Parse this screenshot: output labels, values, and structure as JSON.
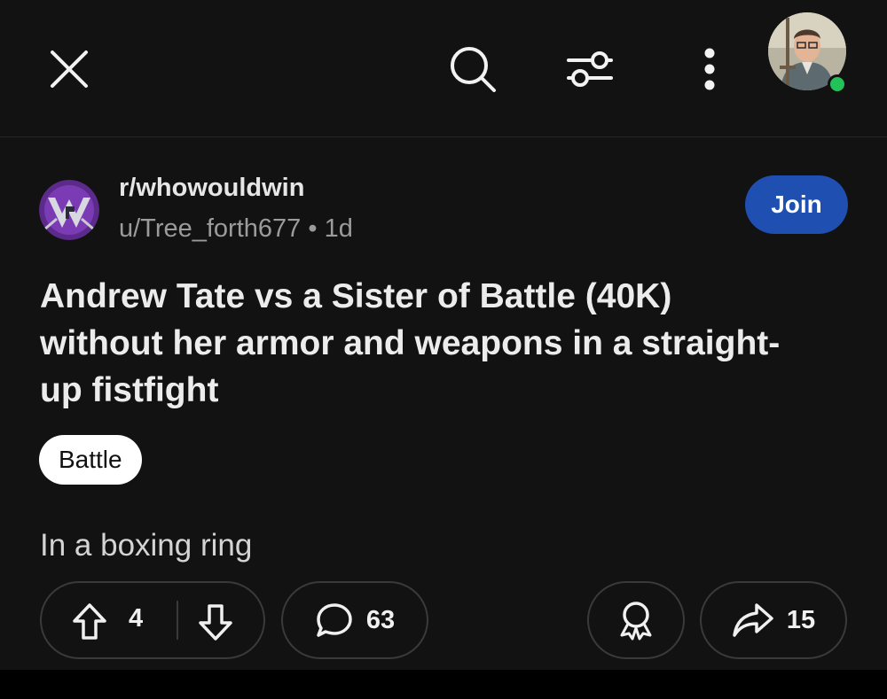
{
  "topbar": {
    "close_icon": "close-icon",
    "search_icon": "search-icon",
    "filter_icon": "sliders-icon",
    "more_icon": "more-vertical-icon",
    "online_status_color": "#23c15a"
  },
  "post": {
    "subreddit": "r/whowouldwin",
    "author": "u/Tree_forth677",
    "separator": "•",
    "age": "1d",
    "join_label": "Join",
    "title": "Andrew Tate vs a Sister of Battle (40K) without her armor and weapons in a straight-up fistfight",
    "flair": "Battle",
    "body": "In a boxing ring"
  },
  "actions": {
    "upvotes": "4",
    "comments": "63",
    "shares": "15"
  },
  "colors": {
    "background": "#121212",
    "join_button": "#1f4fb1",
    "flair_background": "#ffffff"
  }
}
